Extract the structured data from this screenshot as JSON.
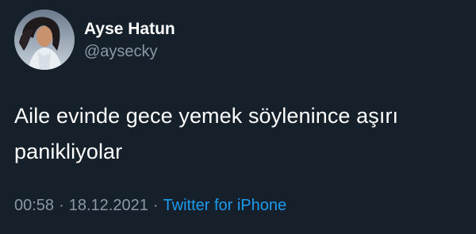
{
  "author": {
    "name": "Ayse Hatun",
    "handle": "@aysecky",
    "avatar_icon": "profile-avatar"
  },
  "tweet": {
    "text": "Aile evinde gece yemek söylenince aşırı panikliyolar"
  },
  "meta": {
    "time": "00:58",
    "separator": "·",
    "date": "18.12.2021",
    "source": "Twitter for iPhone"
  },
  "colors": {
    "background": "#15202b",
    "text": "#ffffff",
    "secondary_text": "#8b98a5",
    "link": "#1d9bf0"
  }
}
